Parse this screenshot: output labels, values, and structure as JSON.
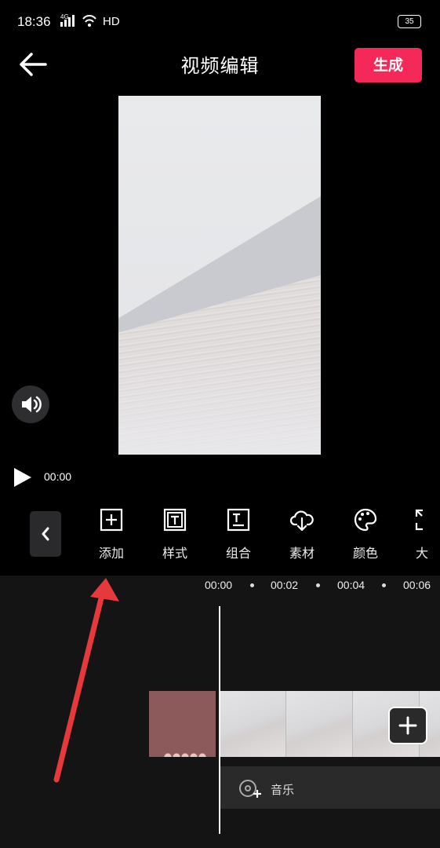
{
  "status_bar": {
    "time": "18:36",
    "signal": "4G",
    "network_label": "HD",
    "battery": "35"
  },
  "header": {
    "title": "视频编辑",
    "generate_label": "生成"
  },
  "player": {
    "current_time": "00:00"
  },
  "toolbar": {
    "items": [
      {
        "label": "添加",
        "icon": "add-square-icon"
      },
      {
        "label": "样式",
        "icon": "text-style-icon"
      },
      {
        "label": "组合",
        "icon": "text-combo-icon"
      },
      {
        "label": "素材",
        "icon": "cloud-download-icon"
      },
      {
        "label": "颜色",
        "icon": "palette-icon"
      },
      {
        "label": "大",
        "icon": "resize-icon"
      }
    ]
  },
  "timeline": {
    "ruler": [
      "00:00",
      "00:02",
      "00:04",
      "00:06"
    ],
    "music_label": "音乐"
  },
  "colors": {
    "accent": "#f5285a",
    "annotation_arrow": "#e5393c"
  }
}
